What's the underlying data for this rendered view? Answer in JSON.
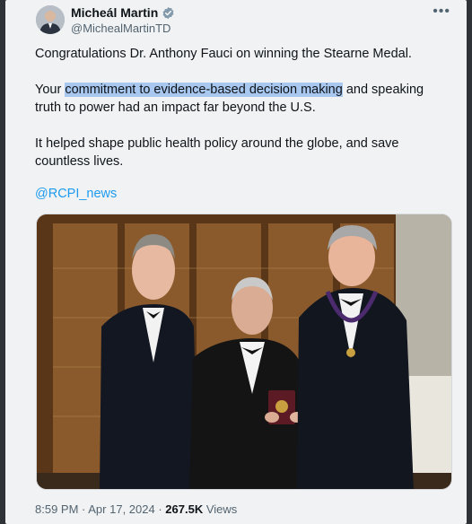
{
  "author": {
    "name": "Micheál Martin",
    "handle": "@MichealMartinTD",
    "verified_icon": "verified-badge-icon"
  },
  "more_label": "•••",
  "tweet": {
    "line1": "Congratulations Dr. Anthony Fauci on winning the Stearne Medal.",
    "p2_before": "Your ",
    "p2_highlight": "commitment to evidence-based decision making",
    "p2_after": " and speaking truth to power had an impact far beyond the U.S.",
    "p3": "It helped shape public health policy around the globe, and save countless lives.",
    "mention": "@RCPI_news"
  },
  "meta": {
    "time": "8:59 PM",
    "sep1": " · ",
    "date": "Apr 17, 2024",
    "sep2": " · ",
    "views_count": "267.5K",
    "views_label": " Views"
  },
  "colors": {
    "background": "#f1f2f3",
    "link": "#1d9bf0",
    "highlight": "#a9c8f0",
    "verified": "#829aab"
  }
}
